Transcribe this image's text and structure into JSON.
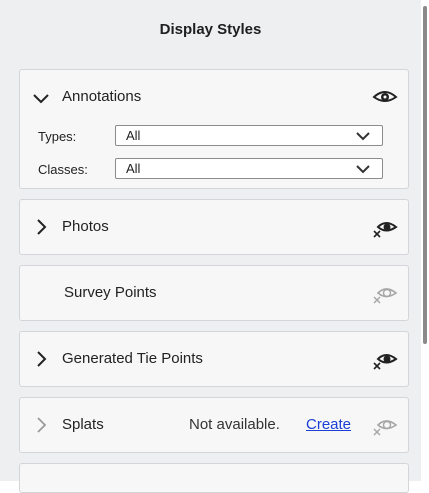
{
  "header": {
    "title": "Display Styles"
  },
  "annotations": {
    "title": "Annotations",
    "types_label": "Types:",
    "types_value": "All",
    "classes_label": "Classes:",
    "classes_value": "All"
  },
  "photos": {
    "title": "Photos"
  },
  "survey_points": {
    "title": "Survey Points"
  },
  "generated_tie_points": {
    "title": "Generated Tie Points"
  },
  "splats": {
    "title": "Splats",
    "status": "Not available.",
    "create_link": "Create"
  },
  "icons": {
    "expand": "chevron-down-icon",
    "collapse": "chevron-right-icon",
    "visible": "eye-icon",
    "hidden": "eye-crossed-icon"
  }
}
